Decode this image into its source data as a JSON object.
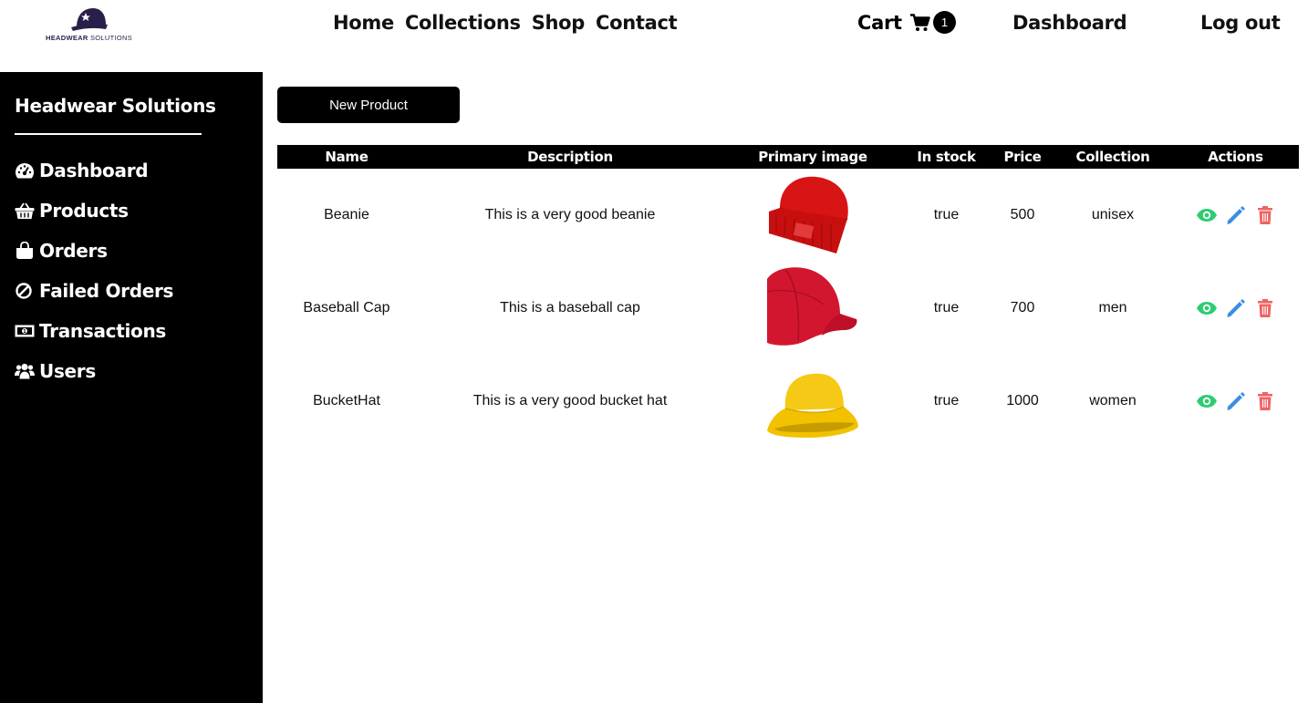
{
  "logo": {
    "text_bold": "HEADWEAR",
    "text_light": " SOLUTIONS"
  },
  "nav": {
    "links": [
      "Home",
      "Collections",
      "Shop",
      "Contact"
    ],
    "cart_label": "Cart",
    "cart_count": "1",
    "dashboard_label": "Dashboard",
    "logout_label": "Log out"
  },
  "sidebar": {
    "brand": "Headwear Solutions",
    "items": [
      {
        "label": "Dashboard",
        "icon": "dashboard-icon"
      },
      {
        "label": "Products",
        "icon": "basket-icon"
      },
      {
        "label": "Orders",
        "icon": "shopping-bag-icon"
      },
      {
        "label": "Failed Orders",
        "icon": "ban-icon"
      },
      {
        "label": "Transactions",
        "icon": "money-bill-icon"
      },
      {
        "label": "Users",
        "icon": "users-icon"
      }
    ]
  },
  "main": {
    "new_product_label": "New Product",
    "table": {
      "headers": [
        "Name",
        "Description",
        "Primary image",
        "In stock",
        "Price",
        "Collection",
        "Actions"
      ],
      "rows": [
        {
          "name": "Beanie",
          "description": "This is a very good beanie",
          "image": "red-beanie-image",
          "in_stock": "true",
          "price": "500",
          "collection": "unisex"
        },
        {
          "name": "Baseball Cap",
          "description": "This is a baseball cap",
          "image": "red-baseball-cap-image",
          "in_stock": "true",
          "price": "700",
          "collection": "men"
        },
        {
          "name": "BucketHat",
          "description": "This is a very good bucket hat",
          "image": "yellow-bucket-hat-image",
          "in_stock": "true",
          "price": "1000",
          "collection": "women"
        }
      ]
    }
  },
  "colors": {
    "view": "#2ecc71",
    "edit": "#3b8fe0",
    "delete": "#f06262",
    "sidebar_bg": "#000000"
  }
}
